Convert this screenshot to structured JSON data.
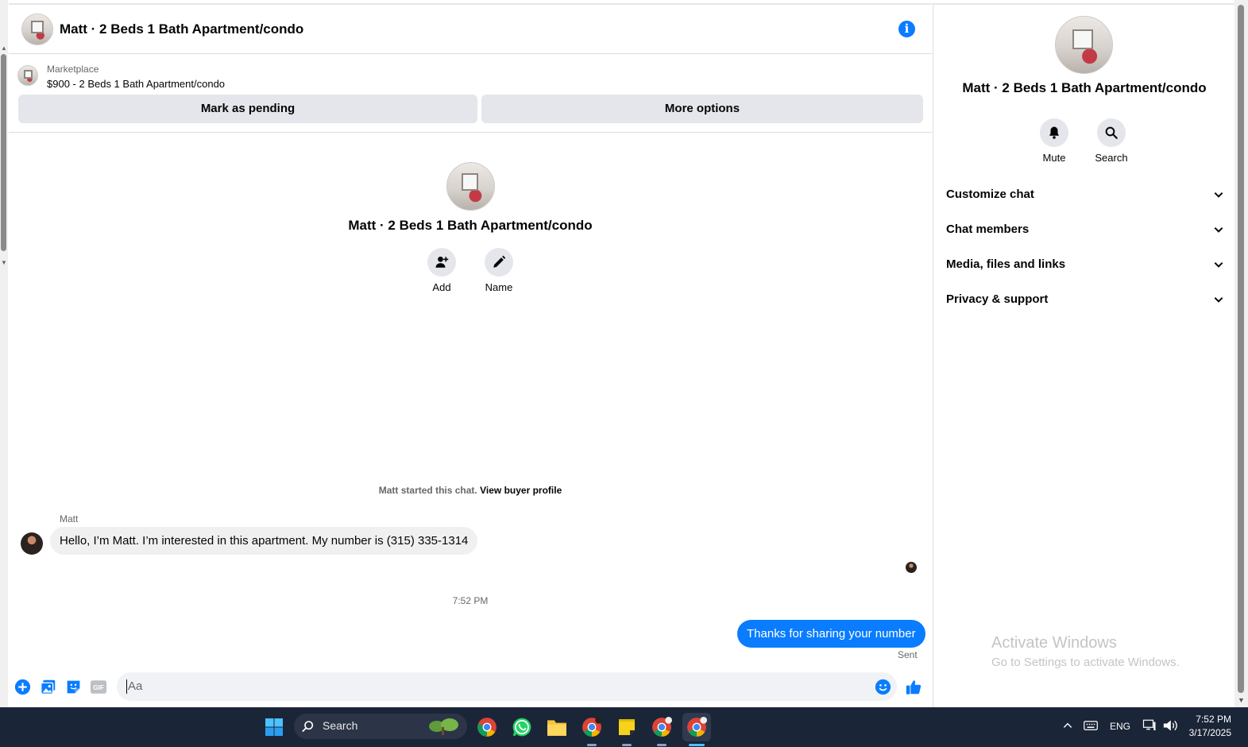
{
  "chat": {
    "title": "Matt · 2 Beds 1 Bath Apartment/condo",
    "marketplace_label": "Marketplace",
    "listing": "$900 - 2 Beds 1 Bath Apartment/condo",
    "mark_pending": "Mark as pending",
    "more_options": "More options",
    "center_title": "Matt · 2 Beds 1 Bath Apartment/condo",
    "add_label": "Add",
    "name_label": "Name",
    "started_prefix": "Matt started this chat.",
    "view_buyer_profile": "View buyer profile",
    "sender": "Matt",
    "incoming_message": "Hello, I’m Matt. I’m interested in this apartment. My number is (315) 335-1314",
    "timestamp": "7:52 PM",
    "outgoing_message": "Thanks for sharing your number",
    "sent_status": "Sent",
    "composer_placeholder": "Aa",
    "colors": {
      "accent": "#0a7cff",
      "bubble_in": "#f0f0f0",
      "button_bg": "#e4e6eb"
    }
  },
  "details": {
    "title": "Matt · 2 Beds 1 Bath Apartment/condo",
    "mute": "Mute",
    "search": "Search",
    "sections": [
      {
        "label": "Customize chat"
      },
      {
        "label": "Chat members"
      },
      {
        "label": "Media, files and links"
      },
      {
        "label": "Privacy & support"
      }
    ]
  },
  "watermark": {
    "title": "Activate Windows",
    "subtitle": "Go to Settings to activate Windows."
  },
  "taskbar": {
    "search_label": "Search",
    "language": "ENG",
    "time": "7:52 PM",
    "date": "3/17/2025",
    "icons": [
      "windows-start-icon",
      "search-icon",
      "widgets-icon",
      "chrome-icon",
      "whatsapp-icon",
      "file-explorer-icon",
      "chrome-profile-icon",
      "sticky-notes-icon",
      "chrome-profile-icon",
      "chrome-profile-icon"
    ]
  }
}
